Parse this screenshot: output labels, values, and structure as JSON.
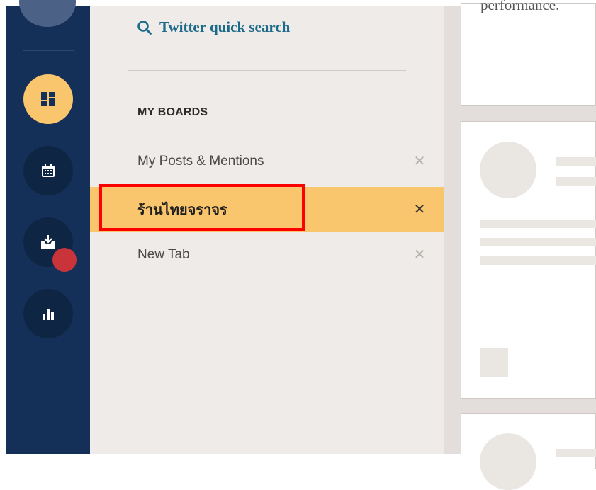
{
  "search": {
    "label": "Twitter quick search"
  },
  "boards": {
    "title": "MY BOARDS",
    "items": [
      {
        "label": "My Posts & Mentions",
        "selected": false
      },
      {
        "label": "ร้านไทยจราจร",
        "selected": true
      },
      {
        "label": "New Tab",
        "selected": false
      }
    ],
    "close_glyph": "✕"
  },
  "content": {
    "card_text": "performance."
  },
  "colors": {
    "nav": "#143059",
    "accent": "#f9c56d",
    "badge": "#c8343a",
    "link": "#1c6a8a",
    "highlight": "#ff0000"
  },
  "icons": [
    "dashboard-icon",
    "calendar-icon",
    "inbox-download-icon",
    "analytics-icon",
    "search-icon",
    "close-icon"
  ]
}
